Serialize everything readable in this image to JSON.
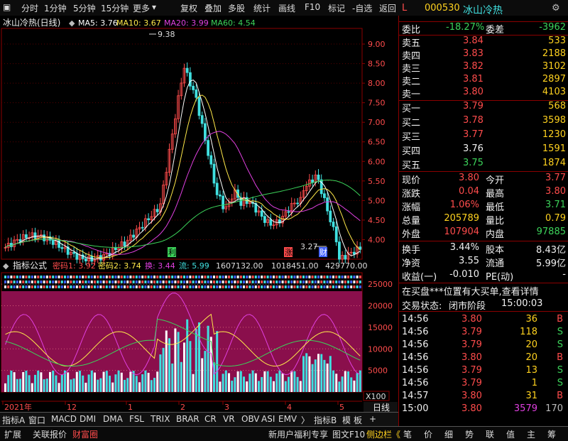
{
  "toolbar": {
    "periods": [
      "分时",
      "1分钟",
      "5分钟",
      "15分钟",
      "更多"
    ],
    "tools": [
      "复权",
      "叠加",
      "多股",
      "统计",
      "画线",
      "F10",
      "标记",
      "-自选",
      "返回"
    ]
  },
  "chart_header": {
    "name": "冰山冷热(日线)",
    "ma5": "MA5: 3.76",
    "ma10": "MA10: 3.67",
    "ma20": "MA20: 3.99",
    "ma60": "MA60: 4.54"
  },
  "price_axis": [
    "9.00",
    "8.50",
    "8.00",
    "7.50",
    "7.00",
    "6.50",
    "6.00",
    "5.50",
    "5.00",
    "4.50",
    "4.00"
  ],
  "price_labels": {
    "high": "9.38",
    "low": "3.27"
  },
  "markers": {
    "m1": "利",
    "m2": "涨",
    "m3": "财"
  },
  "indicator_header": {
    "name": "指标公式",
    "mm1": "密码1: 3.92",
    "mm2": "密码2: 3.74",
    "huan": "换: 3.44",
    "liu": "流: 5.99",
    "v1": "1607132.00",
    "v2": "1018451.00",
    "v3": "429770.00"
  },
  "volume_axis": [
    "25000",
    "20000",
    "15000",
    "10000",
    "5000"
  ],
  "volume_unit": "X100",
  "time_axis": {
    "labels": [
      "2021年",
      "12",
      "1",
      "2",
      "3",
      "4",
      "5"
    ],
    "period": "日线"
  },
  "indicator_tabs": [
    "指标A",
    "窗口",
    "MACD",
    "DMI",
    "DMA",
    "FSL",
    "TRIX",
    "BRAR",
    "CR",
    "VR",
    "OBV",
    "ASI",
    "EMV",
    "〉",
    "指标B",
    "模",
    "板",
    "+"
  ],
  "status": {
    "left": [
      "扩展",
      "关联报价",
      "财富圈"
    ],
    "right": [
      "新用户福利专享",
      "图文F10",
      "侧边栏《"
    ],
    "panel": [
      "笔",
      "价",
      "细",
      "势",
      "联",
      "值",
      "主",
      "筹"
    ]
  },
  "quote": {
    "marker": "L",
    "code": "000530",
    "name": "冰山冷热",
    "weibi_label": "委比",
    "weibi": "-18.27%",
    "weicha_label": "委差",
    "weicha": "-3962",
    "asks": [
      {
        "label": "卖五",
        "price": "3.84",
        "vol": "533"
      },
      {
        "label": "卖四",
        "price": "3.83",
        "vol": "2188"
      },
      {
        "label": "卖三",
        "price": "3.82",
        "vol": "3102"
      },
      {
        "label": "卖二",
        "price": "3.81",
        "vol": "2897"
      },
      {
        "label": "卖一",
        "price": "3.80",
        "vol": "4103"
      }
    ],
    "bids": [
      {
        "label": "买一",
        "price": "3.79",
        "vol": "568"
      },
      {
        "label": "买二",
        "price": "3.78",
        "vol": "3598"
      },
      {
        "label": "买三",
        "price": "3.77",
        "vol": "1230"
      },
      {
        "label": "买四",
        "price": "3.76",
        "vol": "1591"
      },
      {
        "label": "买五",
        "price": "3.75",
        "vol": "1874"
      }
    ],
    "stats": [
      {
        "l1": "现价",
        "v1": "3.80",
        "l2": "今开",
        "v2": "3.77"
      },
      {
        "l1": "涨跌",
        "v1": "0.04",
        "l2": "最高",
        "v2": "3.80"
      },
      {
        "l1": "涨幅",
        "v1": "1.06%",
        "l2": "最低",
        "v2": "3.71"
      },
      {
        "l1": "总量",
        "v1": "205789",
        "l2": "量比",
        "v2": "0.79"
      },
      {
        "l1": "外盘",
        "v1": "107904",
        "l2": "内盘",
        "v2": "97885"
      }
    ],
    "stats2": [
      {
        "l1": "换手",
        "v1": "3.44%",
        "l2": "股本",
        "v2": "8.43亿"
      },
      {
        "l1": "净资",
        "v1": "3.55",
        "l2": "流通",
        "v2": "5.99亿"
      },
      {
        "l1": "收益(一)",
        "v1": "-0.010",
        "l2": "PE(动)",
        "v2": "-"
      }
    ],
    "notice": "在买盘***位置有大买单,查看详情",
    "trade_state_label": "交易状态:",
    "trade_state": "闭市阶段",
    "trade_time": "15:00:03",
    "ticks": [
      {
        "t": "14:56",
        "p": "3.80",
        "v": "36",
        "d": "B"
      },
      {
        "t": "14:56",
        "p": "3.79",
        "v": "118",
        "d": "S"
      },
      {
        "t": "14:56",
        "p": "3.79",
        "v": "20",
        "d": "S"
      },
      {
        "t": "14:56",
        "p": "3.80",
        "v": "20",
        "d": "B"
      },
      {
        "t": "14:56",
        "p": "3.79",
        "v": "13",
        "d": "S"
      },
      {
        "t": "14:56",
        "p": "3.79",
        "v": "1",
        "d": "S"
      },
      {
        "t": "14:57",
        "p": "3.80",
        "v": "31",
        "d": "B"
      },
      {
        "t": "15:00",
        "p": "3.80",
        "v": "3579",
        "d": "170"
      }
    ]
  },
  "colors": {
    "up": "#ff4c4c",
    "down": "#3cd35a",
    "ma5": "#ffffff",
    "ma10": "#ffe94a",
    "ma20": "#e040e0",
    "ma60": "#3cd35a",
    "grid": "#8b0000",
    "indicator_bg": "#8a0f4c"
  }
}
